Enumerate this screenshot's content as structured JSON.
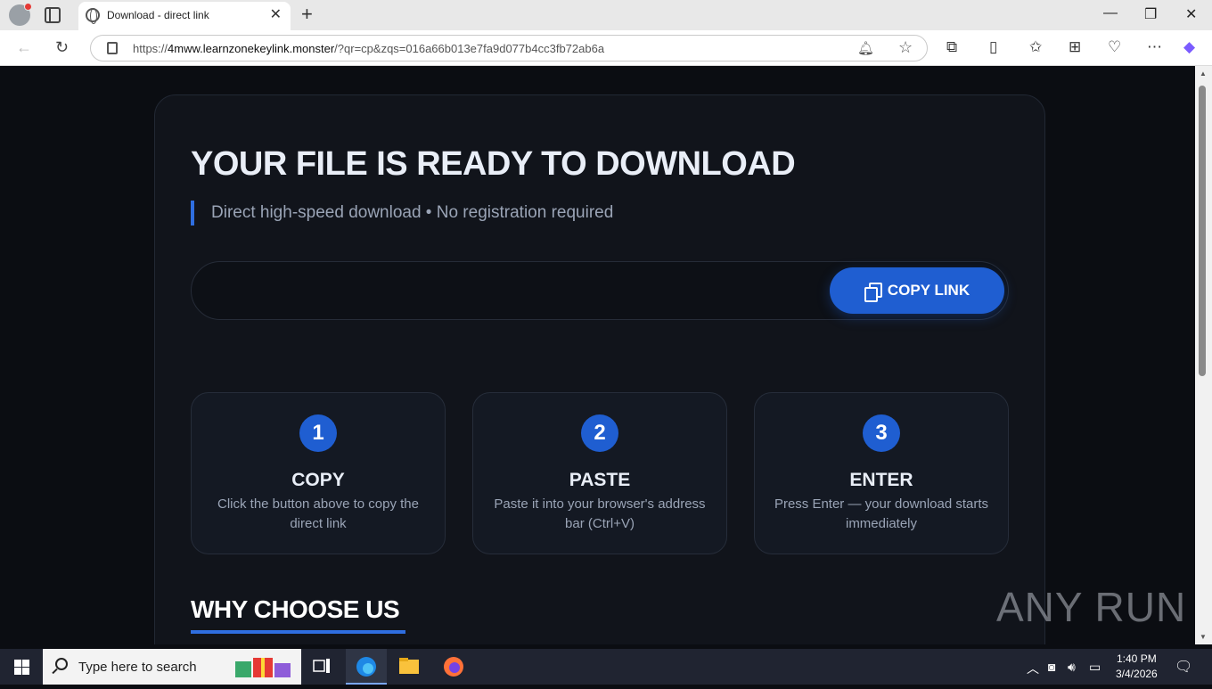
{
  "browser": {
    "tab_title": "Download - direct link",
    "url_prefix": "https://",
    "url_domain": "4mww.learnzonekeylink.monster",
    "url_rest": "/?qr=cp&zqs=016a66b013e7fa9d077b4cc3fb72ab6a"
  },
  "page": {
    "headline": "YOUR FILE IS READY TO DOWNLOAD",
    "subtitle": "Direct high-speed download • No registration required",
    "copy_button": "COPY LINK",
    "steps": [
      {
        "number": "1",
        "title": "COPY",
        "desc": "Click the button above to copy the direct link"
      },
      {
        "number": "2",
        "title": "PASTE",
        "desc": "Paste it into your browser's address bar (Ctrl+V)"
      },
      {
        "number": "3",
        "title": "ENTER",
        "desc": "Press Enter — your download starts immediately"
      }
    ],
    "why_heading": "WHY CHOOSE US",
    "accent_color": "#1f5ed1"
  },
  "watermark": "ANY RUN",
  "taskbar": {
    "search_placeholder": "Type here to search",
    "time": "1:40 PM",
    "date": "3/4/2026"
  }
}
